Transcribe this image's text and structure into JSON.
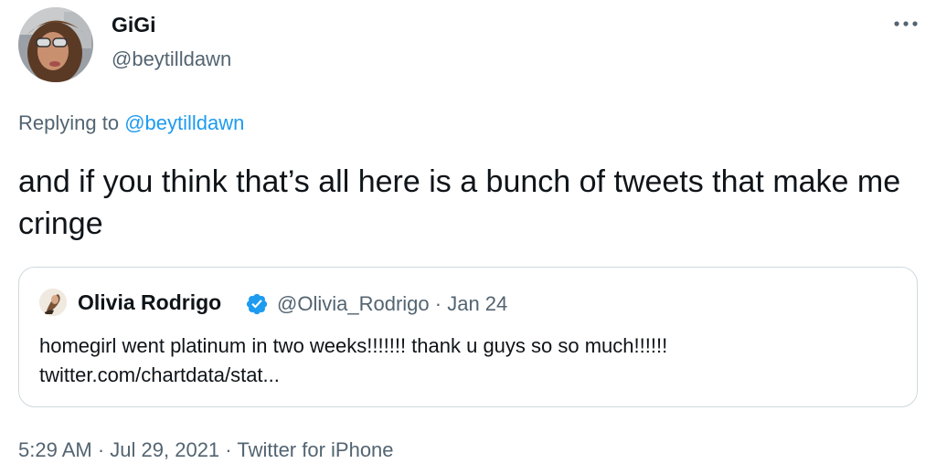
{
  "author": {
    "display_name": "GiGi",
    "handle": "@beytilldawn",
    "avatar_icon": "profile-photo"
  },
  "menu": {
    "icon": "more-horizontal-icon"
  },
  "reply": {
    "prefix": "Replying to",
    "mention": "@beytilldawn"
  },
  "tweet": {
    "text": "and if you think that’s all here is a bunch of tweets that make me cringe"
  },
  "quote": {
    "display_name": "Olivia Rodrigo",
    "verified": true,
    "handle": "@Olivia_Rodrigo",
    "separator": "·",
    "date": "Jan 24",
    "text": "homegirl went platinum in two weeks!!!!!!! thank u guys so so much!!!!!!",
    "link": "twitter.com/chartdata/stat..."
  },
  "footer": {
    "time": "5:29 AM",
    "sep1": "·",
    "date": "Jul 29, 2021",
    "sep2": "·",
    "source": "Twitter for iPhone"
  },
  "colors": {
    "text": "#0f1419",
    "secondary": "#536471",
    "link": "#1d9bf0",
    "border": "#cfd9de",
    "verified": "#1d9bf0"
  }
}
